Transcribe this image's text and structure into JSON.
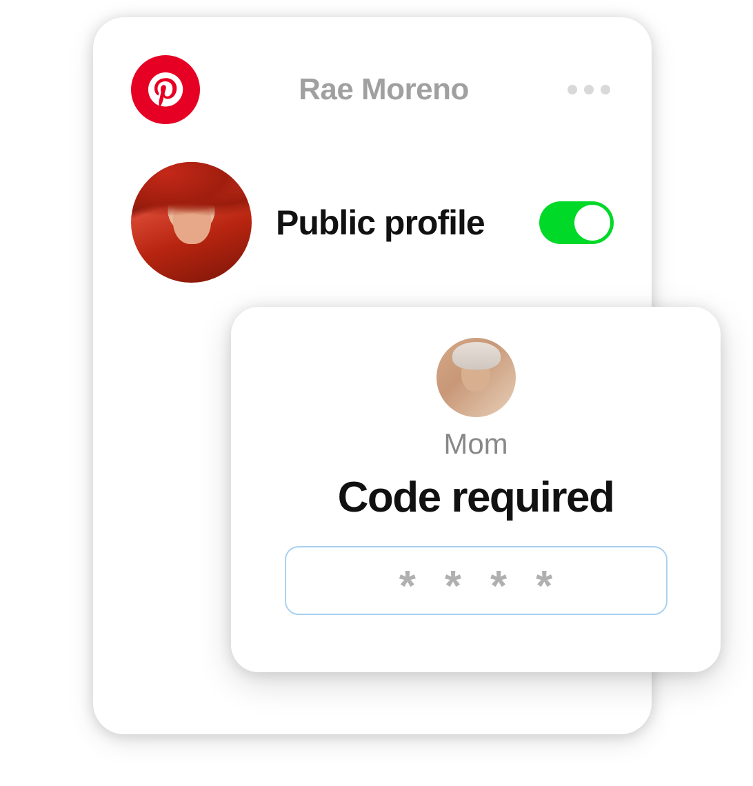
{
  "header": {
    "user_name": "Rae Moreno"
  },
  "profile": {
    "toggle_label": "Public profile",
    "toggle_on": true
  },
  "overlay": {
    "parent_label": "Mom",
    "title": "Code required",
    "code_mask": [
      "*",
      "*",
      "*",
      "*"
    ]
  },
  "colors": {
    "brand": "#e60023",
    "toggle_on": "#00d928",
    "input_border": "#a8d0f0"
  }
}
